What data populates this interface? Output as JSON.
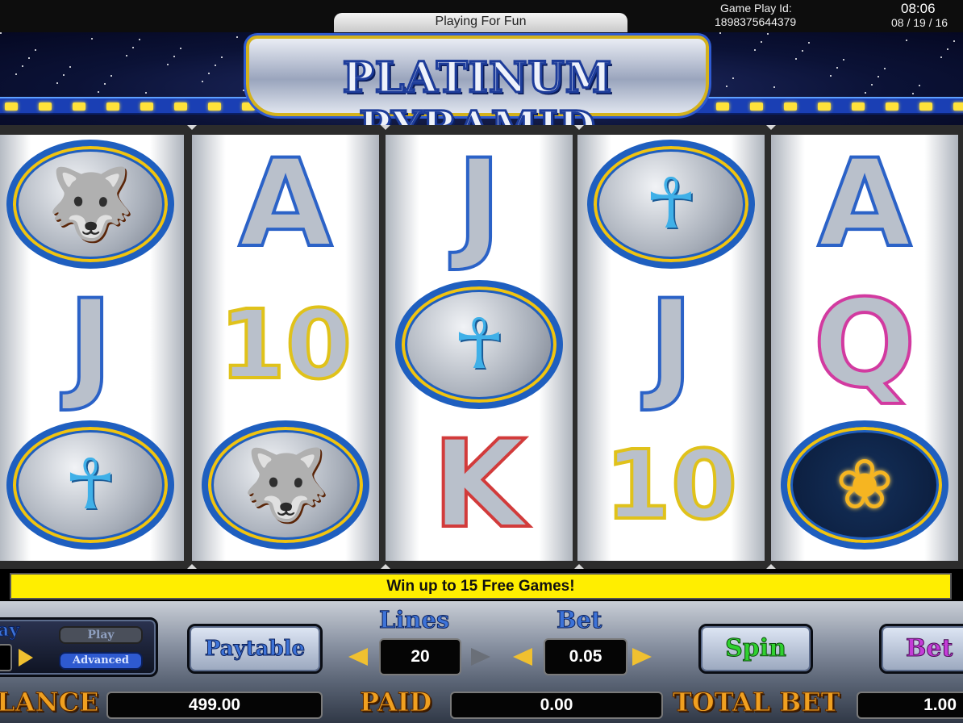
{
  "status": {
    "mode_label": "Playing For Fun",
    "game_play_id_label": "Game Play Id:",
    "game_play_id": "1898375644379",
    "time": "08:06",
    "date": "08 / 19 / 16"
  },
  "title": "PLATINUM PYRAMID",
  "reels": [
    [
      "jackal",
      "J",
      "ankh"
    ],
    [
      "A",
      "10",
      "jackal"
    ],
    [
      "J",
      "ankh",
      "K"
    ],
    [
      "ankh",
      "J",
      "10"
    ],
    [
      "A",
      "Q",
      "lotus"
    ]
  ],
  "marquee": "Win up to 15 Free Games!",
  "controls": {
    "play_label_partial": "ay",
    "play_button": "Play",
    "advanced_button": "Advanced",
    "paytable_button": "Paytable",
    "lines_label": "Lines",
    "lines_value": "20",
    "bet_label": "Bet",
    "bet_value": "0.05",
    "spin_button": "Spin",
    "bet_max_button": "Bet"
  },
  "meters": {
    "balance_label": "LANCE",
    "balance_value": "499.00",
    "paid_label": "PAID",
    "paid_value": "0.00",
    "total_bet_label": "TOTAL BET",
    "total_bet_value": "1.00"
  },
  "icons": {
    "jackal": "jackal-canopic-icon",
    "ankh": "ankh-icon",
    "lotus": "lotus-flower-icon"
  },
  "colors": {
    "marquee_bg": "#ffee00",
    "strip_bulb": "#ffe23a",
    "medal_border": "#1f5fbf"
  }
}
